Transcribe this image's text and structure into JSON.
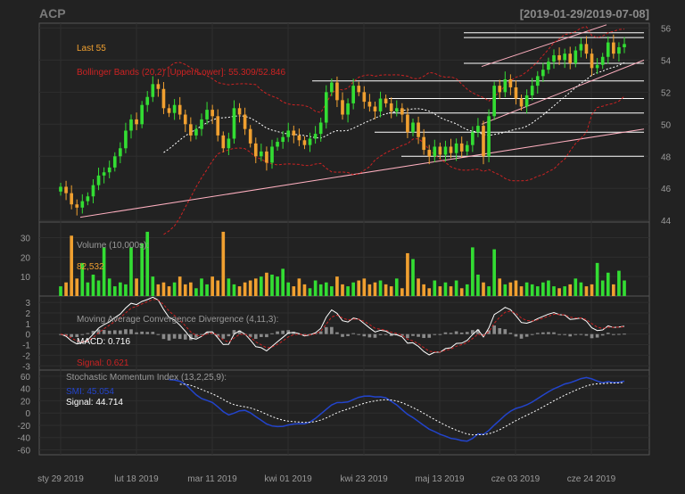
{
  "header": {
    "symbol": "ACP",
    "date_range": "[2019-01-29/2019-07-08]"
  },
  "colors": {
    "background": "#222222",
    "up_candle": "#33dd33",
    "down_candle": "#f0a030",
    "bollinger": "#cc2222",
    "sma": "#ffffff",
    "macd_line": "#ffffff",
    "macd_signal": "#cc2222",
    "smi_line": "#2244cc",
    "smi_signal": "#ffffff",
    "trend_line": "#ffb0c0"
  },
  "chart_data": [
    {
      "type": "candlestick",
      "panel": "price",
      "legend": {
        "last": "Last 55",
        "bollinger": "Bollinger Bands (20,2) [Upper/Lower]: 55.309/52.846"
      },
      "y_ticks": [
        44,
        46,
        48,
        50,
        52,
        54,
        56
      ],
      "ylim": [
        43.9,
        56.3
      ],
      "x_tick_labels": [
        "sty 29 2019",
        "lut 18 2019",
        "mar 11 2019",
        "kwi 01 2019",
        "kwi 23 2019",
        "maj 13 2019",
        "cze 03 2019",
        "cze 24 2019"
      ],
      "close": [
        46.1,
        45.7,
        45.0,
        44.8,
        45.2,
        45.5,
        46.2,
        46.8,
        47.0,
        47.3,
        48.0,
        48.5,
        49.6,
        50.3,
        50.0,
        51.2,
        51.7,
        52.5,
        52.2,
        51.0,
        50.7,
        51.2,
        50.6,
        50.0,
        49.3,
        49.7,
        50.3,
        50.9,
        50.5,
        49.3,
        48.5,
        49.1,
        51.0,
        50.6,
        49.7,
        48.8,
        48.0,
        48.3,
        47.6,
        48.6,
        48.9,
        49.2,
        49.6,
        49.3,
        49.0,
        48.7,
        49.1,
        49.4,
        50.1,
        52.0,
        52.6,
        51.5,
        50.6,
        51.3,
        52.4,
        52.0,
        51.4,
        51.1,
        50.8,
        51.6,
        51.3,
        50.8,
        51.0,
        50.6,
        49.5,
        50.1,
        49.2,
        48.4,
        48.0,
        48.6,
        48.1,
        48.6,
        48.2,
        48.8,
        48.3,
        48.7,
        49.5,
        49.9,
        48.0,
        50.5,
        52.4,
        52.0,
        52.8,
        52.3,
        51.6,
        51.1,
        51.8,
        52.4,
        53.0,
        53.4,
        53.9,
        54.3,
        54.0,
        54.4,
        53.8,
        54.6,
        55.0,
        54.4,
        53.5,
        53.7,
        54.2,
        55.1,
        54.4,
        54.8,
        55.0
      ],
      "volume_panel": {
        "label": "Volume (10,000s):",
        "last_value": "82,532",
        "y_ticks": [
          10,
          20,
          30
        ],
        "ylim": [
          0,
          38
        ],
        "values": [
          5,
          7,
          31,
          9,
          17,
          7,
          11,
          8,
          25,
          9,
          5,
          7,
          6,
          25,
          9,
          27,
          33,
          10,
          6,
          7,
          5,
          7,
          10,
          6,
          7,
          4,
          9,
          6,
          10,
          8,
          33,
          9,
          6,
          5,
          7,
          8,
          9,
          10,
          12,
          11,
          10,
          14,
          7,
          5,
          9,
          6,
          4,
          8,
          6,
          7,
          5,
          10,
          6,
          5,
          7,
          8,
          9,
          6,
          7,
          8,
          6,
          5,
          9,
          4,
          22,
          19,
          9,
          6,
          4,
          8,
          5,
          7,
          5,
          8,
          4,
          6,
          25,
          11,
          7,
          5,
          24,
          9,
          6,
          7,
          8,
          5,
          7,
          6,
          5,
          7,
          8,
          5,
          4,
          5,
          6,
          9,
          7,
          5,
          6,
          17,
          8,
          12,
          6,
          13,
          8
        ]
      },
      "horizontal_lines": [
        48.0,
        49.5,
        50.7,
        51.6,
        52.7,
        53.8,
        55.4,
        55.7
      ]
    },
    {
      "type": "line",
      "panel": "macd",
      "legend": {
        "title": "Moving Average Convergence Divergence (4,11,3):",
        "macd": "MACD: 0.716",
        "signal": "Signal: 0.621"
      },
      "y_ticks": [
        -3,
        -2,
        -1,
        0,
        1,
        2,
        3
      ],
      "ylim": [
        -3.4,
        3.6
      ]
    },
    {
      "type": "line",
      "panel": "smi",
      "legend": {
        "title": "Stochastic Momentum Index (13,2,25,9):",
        "smi": "SMI: 45.054",
        "signal": "Signal: 44.714"
      },
      "y_ticks": [
        -60,
        -40,
        -20,
        0,
        20,
        40,
        60
      ],
      "ylim": [
        -68,
        70
      ]
    }
  ]
}
